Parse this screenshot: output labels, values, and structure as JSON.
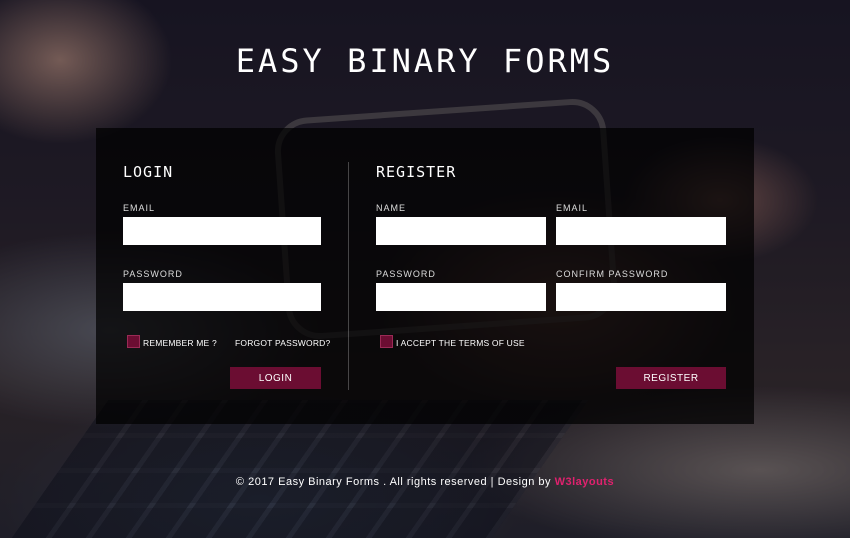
{
  "page": {
    "title": "EASY BINARY FORMS"
  },
  "login": {
    "heading": "LOGIN",
    "email_label": "EMAIL",
    "email_value": "",
    "password_label": "PASSWORD",
    "password_value": "",
    "remember_label": "REMEMBER ME ?",
    "forgot_label": "FORGOT PASSWORD?",
    "submit_label": "LOGIN"
  },
  "register": {
    "heading": "REGISTER",
    "name_label": "NAME",
    "name_value": "",
    "email_label": "EMAIL",
    "email_value": "",
    "password_label": "PASSWORD",
    "password_value": "",
    "confirm_label": "CONFIRM PASSWORD",
    "confirm_value": "",
    "terms_label": "I ACCEPT THE TERMS OF USE",
    "submit_label": "REGISTER"
  },
  "footer": {
    "text": "© 2017 Easy Binary Forms . All rights reserved | Design by ",
    "brand": "W3layouts"
  },
  "colors": {
    "accent": "#6b0d32",
    "brand_link": "#e0216e",
    "panel": "#000000"
  }
}
